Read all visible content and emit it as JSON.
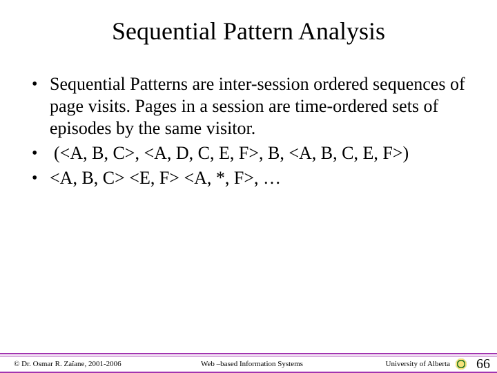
{
  "title": "Sequential Pattern Analysis",
  "bullets": [
    {
      "mark": "•",
      "text": "Sequential Patterns are inter-session ordered sequences of page visits. Pages in a session are time-ordered sets of episodes by the same visitor."
    },
    {
      "mark": "•",
      "text": " (<A, B, C>, <A, D, C, E, F>, B, <A, B, C, E, F>)"
    },
    {
      "mark": "•",
      "text": "<A, B, C>  <E, F> <A, *, F>, …"
    }
  ],
  "footer": {
    "copyright": "© Dr. Osmar R. Zaïane, 2001-2006",
    "center": "Web –based Information Systems",
    "affiliation": "University of Alberta",
    "page": "66"
  }
}
